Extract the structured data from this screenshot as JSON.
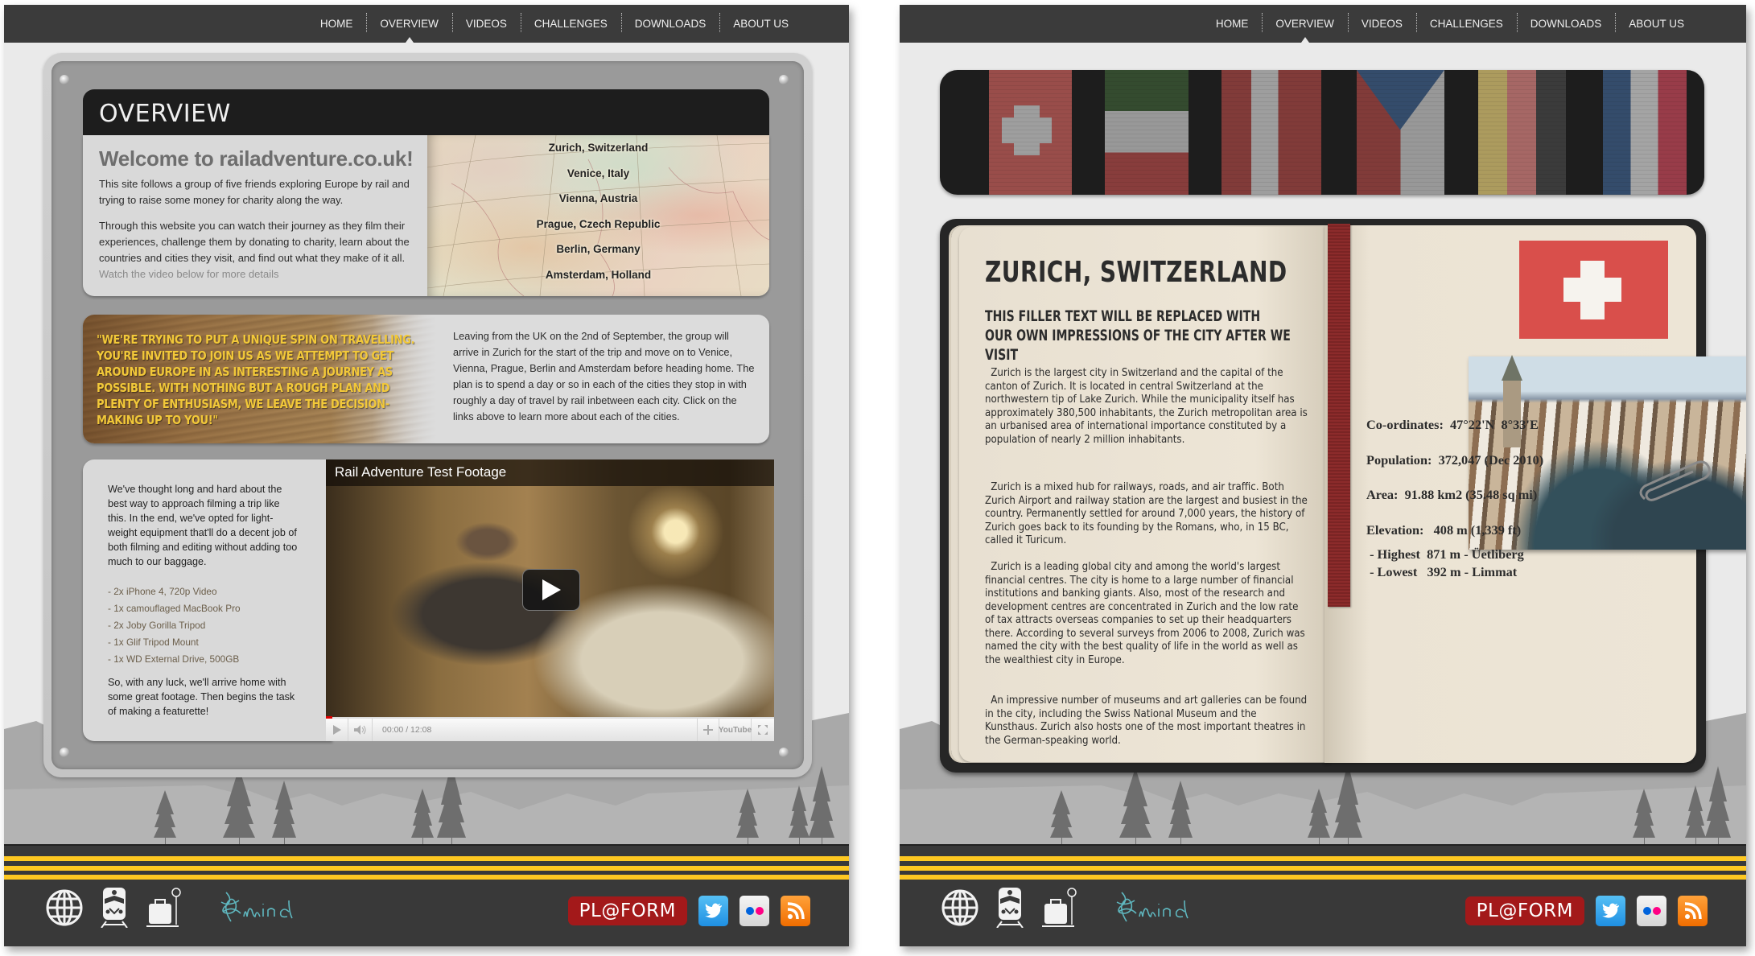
{
  "nav": {
    "items": [
      "HOME",
      "OVERVIEW",
      "VIDEOS",
      "CHALLENGES",
      "DOWNLOADS",
      "ABOUT US"
    ],
    "active": "OVERVIEW"
  },
  "overview": {
    "header": "OVERVIEW",
    "welcome_title": "Welcome to railadventure.co.uk!",
    "intro_p1": "This site follows a group of five friends exploring Europe by rail and trying to raise some money for charity along the way.",
    "intro_p2": "Through this website you can watch their journey as they film their experiences, challenge them by donating to charity, learn about the countries and cities they visit, and find out what they make of it all.",
    "video_hint": "Watch the video below for more details",
    "cities": [
      "Zurich, Switzerland",
      "Venice, Italy",
      "Vienna, Austria",
      "Prague, Czech Republic",
      "Berlin, Germany",
      "Amsterdam, Holland"
    ]
  },
  "quote": {
    "text": "\"We're trying to put a unique spin on travelling. You're invited to join us as we attempt to get around Europe in as interesting a journey as possible. With nothing but a rough plan and plenty of enthusiasm, we leave the decision-making up to you!\"",
    "info": "Leaving from the UK on the 2nd of September, the group will arrive in Zurich for the start of the trip and move on to Venice, Vienna, Prague, Berlin and Amsterdam before heading home. The plan is to spend a day or so in each of the cities they stop in with roughly a day of travel by rail inbetween each city. Click on the links above to learn more about each of the cities."
  },
  "equipment": {
    "intro": "We've thought long and hard about the best way to approach filming a trip like this. In the end, we've opted for light-weight equipment that'll do a decent job of both filming and editing without adding too much to our baggage.",
    "items": [
      "- 2x iPhone 4, 720p Video",
      "- 1x camouflaged MacBook Pro",
      "- 2x Joby Gorilla Tripod",
      "- 1x Glif Tripod Mount",
      "- 1x WD External Drive, 500GB"
    ],
    "outro": "So, with any luck, we'll arrive home with some great footage. Then begins the task of making a featurette!"
  },
  "video": {
    "title": "Rail Adventure Test Footage",
    "current_time": "00:00",
    "duration": "12:08",
    "timecode": "00:00 / 12:08",
    "progress_fraction": 0.0,
    "brand": "YouTube"
  },
  "footer": {
    "icons": [
      "globe-icon",
      "train-icon",
      "luggage-scale-icon"
    ],
    "charity_logo": "mind",
    "platform_label": "PL@FORM",
    "social": [
      "twitter",
      "flickr",
      "rss"
    ],
    "colors": {
      "stripe": "#fec821",
      "rail_bg": "#393939",
      "platform": "#a3191a"
    }
  },
  "flag_strip": {
    "flags": [
      "Switzerland",
      "Italy",
      "Austria",
      "Czech Republic",
      "Germany",
      "Netherlands"
    ]
  },
  "city": {
    "title": "Zurich, Switzerland",
    "subtitle": "This filler text will be replaced with our own impressions of the city after we visit",
    "paragraphs": [
      "Zurich is the largest city in Switzerland and the capital of the canton of Zurich. It is located in central Switzerland at the northwestern tip of Lake Zurich. While the municipality itself has approximately 380,500 inhabitants, the Zurich metropolitan area is an urbanised area of international importance constituted by a population of nearly 2 million inhabitants.",
      "Zurich is a mixed hub for railways, roads, and air traffic. Both Zurich Airport and railway station are the largest and busiest in the country. Permanently settled for around 7,000 years, the history of Zurich goes back to its founding by the Romans, who, in 15 BC, called it Turicum.",
      "Zurich is a leading global city and among the world's largest financial centres. The city is home to a large number of financial institutions and banking giants. Also, most of the research and development centres are concentrated in Zurich and the low rate of tax attracts overseas companies to set up their headquarters there. According to several surveys from 2006 to 2008, Zurich was named the city with the best quality of life in the world as well as the wealthiest city in Europe.",
      "An impressive number of museums and art galleries can be found in the city, including the Swiss National Museum and the Kunsthaus. Zurich also hosts one of the most important theatres in the German-speaking world."
    ],
    "facts": {
      "coordinates": "Co-ordinates:  47°22'N  8°33'E",
      "population": "Population:  372,047 (Dec 2010)",
      "area": "Area:  91.88 km2 (35.48 sq mi)",
      "elevation": "Elevation:   408 m (1,339 ft)",
      "highest": " - Highest  871 m - Üetliberg",
      "lowest": " - Lowest   392 m - Limmat"
    },
    "colors": {
      "flag_red": "#d94f4b",
      "ribbon": "#7a2424"
    }
  }
}
